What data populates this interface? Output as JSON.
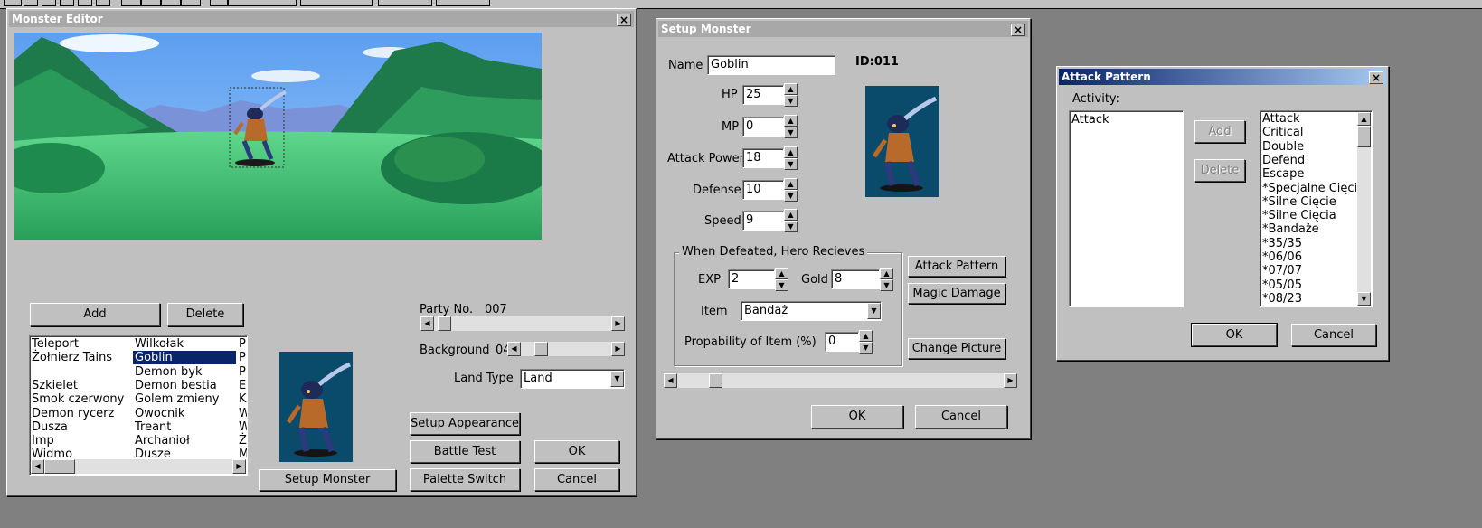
{
  "editor": {
    "title": "Monster Editor",
    "buttons": {
      "add": "Add",
      "delete": "Delete",
      "setup_monster": "Setup Monster",
      "setup_appearance": "Setup Appearance",
      "battle_test": "Battle Test",
      "palette_switch": "Palette Switch",
      "ok": "OK",
      "cancel": "Cancel"
    },
    "party_label": "Party No.",
    "party_value": "007",
    "background_label": "Background",
    "background_value": "04",
    "land_type_label": "Land Type",
    "land_type_value": "Land",
    "monster_list": {
      "col1": [
        "Teleport",
        "Żołnierz Tains",
        "",
        "Szkielet",
        "Smok czerwony",
        "Demon rycerz",
        "Dusza",
        "Imp",
        "Widmo"
      ],
      "col2": [
        "Wilkołak",
        "Goblin",
        "Demon byk",
        "Demon bestia",
        "Golem zmieny",
        "Owocnik",
        "Treant",
        "Archanioł",
        "Dusze"
      ],
      "col3": [
        "P",
        "P",
        "P",
        "E",
        "K",
        "W",
        "W",
        "Ż",
        "M"
      ],
      "selected": "Goblin"
    }
  },
  "setup": {
    "title": "Setup Monster",
    "name_label": "Name",
    "name_value": "Goblin",
    "id_text": "ID:011",
    "hp_label": "HP",
    "hp_value": "25",
    "mp_label": "MP",
    "mp_value": "0",
    "attack_label": "Attack Power",
    "attack_value": "18",
    "defense_label": "Defense",
    "defense_value": "10",
    "speed_label": "Speed",
    "speed_value": "9",
    "group_label": "When Defeated, Hero Recieves",
    "exp_label": "EXP",
    "exp_value": "2",
    "gold_label": "Gold",
    "gold_value": "8",
    "item_label": "Item",
    "item_value": "Bandaż",
    "prob_label": "Propability of Item (%)",
    "prob_value": "0",
    "attack_pattern_btn": "Attack Pattern",
    "magic_damage_btn": "Magic Damage",
    "change_picture_btn": "Change Picture",
    "ok": "OK",
    "cancel": "Cancel"
  },
  "attack": {
    "title": "Attack Pattern",
    "activity_label": "Activity:",
    "activity_items": [
      "Attack"
    ],
    "add": "Add",
    "delete": "Delete",
    "options": [
      "Attack",
      "Critical",
      "Double",
      "Defend",
      "Escape",
      "*Specjalne Cięcia",
      "*Silne Cięcie",
      "*Silne Cięcia",
      "*Bandaże",
      "*35/35",
      "*06/06",
      "*07/07",
      "*05/05",
      "*08/23"
    ],
    "ok": "OK",
    "cancel": "Cancel"
  },
  "colors": {
    "desktop": "#808080",
    "face": "#c0c0c0",
    "selection": "#0a246a",
    "sky": "#5ca0f0",
    "grass": "#3cc070",
    "mountain": "#1e7a4a",
    "sprite_bg": "#0a4a6a"
  },
  "icons": [
    "close-icon",
    "spin-up-icon",
    "spin-down-icon",
    "scroll-left-icon",
    "scroll-right-icon",
    "scroll-up-icon",
    "scroll-down-icon",
    "dropdown-arrow-icon",
    "goblin-sprite"
  ]
}
